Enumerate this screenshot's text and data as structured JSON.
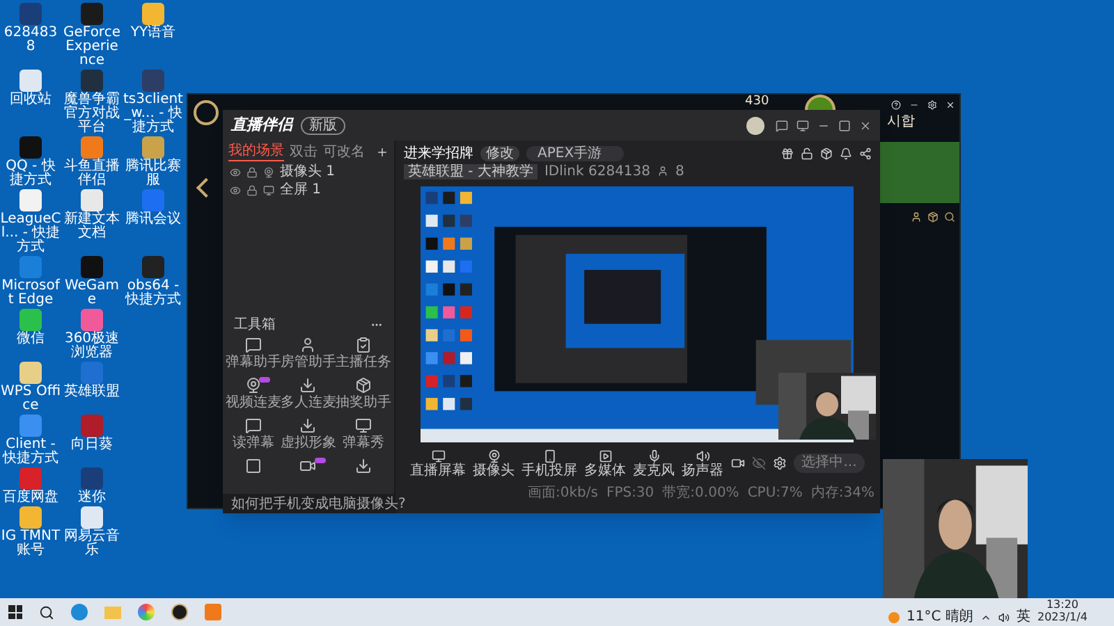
{
  "desktop_rows": [
    [
      {
        "label": "6284838"
      },
      {
        "label": "GeForce Experience"
      },
      {
        "label": "YY语音"
      }
    ],
    [
      {
        "label": "回收站"
      },
      {
        "label": "魔兽争霸官方对战平台"
      },
      {
        "label": "ts3client_w... - 快捷方式"
      }
    ],
    [
      {
        "label": "QQ - 快捷方式"
      },
      {
        "label": "斗鱼直播伴侣"
      },
      {
        "label": "腾讯比赛服"
      }
    ],
    [
      {
        "label": "LeagueCl... - 快捷方式"
      },
      {
        "label": "新建文本文档"
      },
      {
        "label": "腾讯会议"
      }
    ],
    [
      {
        "label": "Microsoft Edge"
      },
      {
        "label": "WeGame"
      },
      {
        "label": "obs64 - 快捷方式"
      }
    ],
    [
      {
        "label": "微信"
      },
      {
        "label": "360极速浏览器"
      }
    ],
    [
      {
        "label": "WPS Office"
      },
      {
        "label": "英雄联盟"
      }
    ],
    [
      {
        "label": "Client - 快捷方式"
      },
      {
        "label": "向日葵"
      }
    ],
    [
      {
        "label": "百度网盘"
      },
      {
        "label": "迷你"
      }
    ],
    [
      {
        "label": "IG TMNT账号"
      },
      {
        "label": "网易云音乐"
      }
    ]
  ],
  "game_client": {
    "coins": "430",
    "player": "시합"
  },
  "streaming_app": {
    "title": "直播伴侣",
    "version_badge": "新版",
    "scene_tabs": [
      {
        "label": "我的场景",
        "selected": true
      },
      {
        "label": "双击",
        "selected": false
      },
      {
        "label": "可改名",
        "selected": false
      }
    ],
    "sources": [
      {
        "label": "摄像头 1",
        "kind": "camera"
      },
      {
        "label": "全屏 1",
        "kind": "screen"
      }
    ],
    "toolbox_title": "工具箱",
    "tools": [
      {
        "label": "弹幕助手",
        "new": false
      },
      {
        "label": "房管助手",
        "new": false
      },
      {
        "label": "主播任务",
        "new": false
      },
      {
        "label": "视频连麦",
        "new": true
      },
      {
        "label": "多人连麦",
        "new": false
      },
      {
        "label": "抽奖助手",
        "new": false
      },
      {
        "label": "读弹幕",
        "new": false
      },
      {
        "label": "虚拟形象",
        "new": false
      },
      {
        "label": "弹幕秀",
        "new": false
      },
      {
        "new": false
      },
      {
        "new": true
      },
      {
        "new": false
      }
    ],
    "hint": "如何把手机变成电脑摄像头?",
    "stream_title": "进来学招牌",
    "edit_button": "修改",
    "game_field": "APEX手游",
    "category": "英雄联盟 - 大神教学",
    "room_id": "IDlink 6284138",
    "fans": "8",
    "controls": [
      {
        "label": "直播屏幕",
        "kind": "screen"
      },
      {
        "label": "摄像头",
        "kind": "camera"
      },
      {
        "label": "手机投屏",
        "kind": "phone"
      },
      {
        "label": "多媒体",
        "kind": "media"
      },
      {
        "label": "麦克风",
        "kind": "mic"
      },
      {
        "label": "扬声器",
        "kind": "speaker"
      }
    ],
    "start_button": "选择中...",
    "stats": [
      "画面:0kb/s",
      "FPS:30",
      "带宽:0.00%",
      "CPU:7%",
      "内存:34%"
    ]
  },
  "taskbar": {
    "weather": "11°C 晴朗",
    "ime": "英",
    "time": "13:20",
    "date": "2023/1/4"
  }
}
